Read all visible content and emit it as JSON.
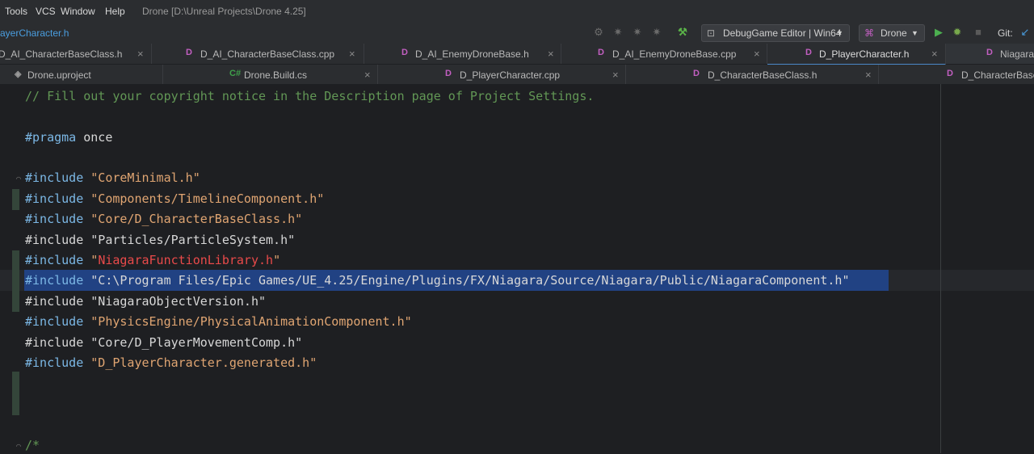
{
  "menu": {
    "items": [
      "Tools",
      "VCS",
      "Window",
      "Help"
    ],
    "window_title": "Drone [D:\\Unreal Projects\\Drone 4.25]"
  },
  "toolbar": {
    "breadcrumb": "ayerCharacter.h",
    "config_combo": "DebugGame Editor | Win64",
    "target_combo": "Drone",
    "git_label": "Git:"
  },
  "tabs_row1": [
    {
      "label": "D_AI_CharacterBaseClass.h",
      "active": false
    },
    {
      "label": "D_AI_CharacterBaseClass.cpp",
      "active": false
    },
    {
      "label": "D_AI_EnemyDroneBase.h",
      "active": false
    },
    {
      "label": "D_AI_EnemyDroneBase.cpp",
      "active": false
    },
    {
      "label": "D_PlayerCharacter.h",
      "active": true
    },
    {
      "label": "NiagaraC",
      "active": false
    }
  ],
  "tabs_row2": [
    {
      "label": "Drone.uproject"
    },
    {
      "label": "Drone.Build.cs"
    },
    {
      "label": "D_PlayerCharacter.cpp"
    },
    {
      "label": "D_CharacterBaseClass.h"
    },
    {
      "label": "D_CharacterBaseC"
    }
  ],
  "code": {
    "comment": "// Fill out your copyright notice in the Description page of Project Settings.",
    "pragma_kw": "#pragma",
    "pragma_val": " once",
    "includes": [
      {
        "kw": "#include",
        "path": "\"CoreMinimal.h\"",
        "style": "normal"
      },
      {
        "kw": "#include",
        "path": "\"Components/TimelineComponent.h\"",
        "style": "normal"
      },
      {
        "kw": "#include",
        "path": "\"Core/D_CharacterBaseClass.h\"",
        "style": "normal"
      },
      {
        "kw": "#include",
        "path": "\"Particles/ParticleSystem.h\"",
        "style": "dim"
      },
      {
        "kw": "#include",
        "path": "\"NiagaraFunctionLibrary.h\"",
        "style": "error"
      },
      {
        "kw": "#include",
        "path": "\"C:\\Program Files/Epic Games/UE_4.25/Engine/Plugins/FX/Niagara/Source/Niagara/Public/NiagaraComponent.h\"",
        "style": "selected"
      },
      {
        "kw": "#include",
        "path": "\"NiagaraObjectVersion.h\"",
        "style": "dim"
      },
      {
        "kw": "#include",
        "path": "\"PhysicsEngine/PhysicalAnimationComponent.h\"",
        "style": "normal"
      },
      {
        "kw": "#include",
        "path": "\"Core/D_PlayerMovementComp.h\"",
        "style": "dim"
      },
      {
        "kw": "#include",
        "path": "\"D_PlayerCharacter.generated.h\"",
        "style": "normal"
      }
    ],
    "trailing": "/*"
  }
}
